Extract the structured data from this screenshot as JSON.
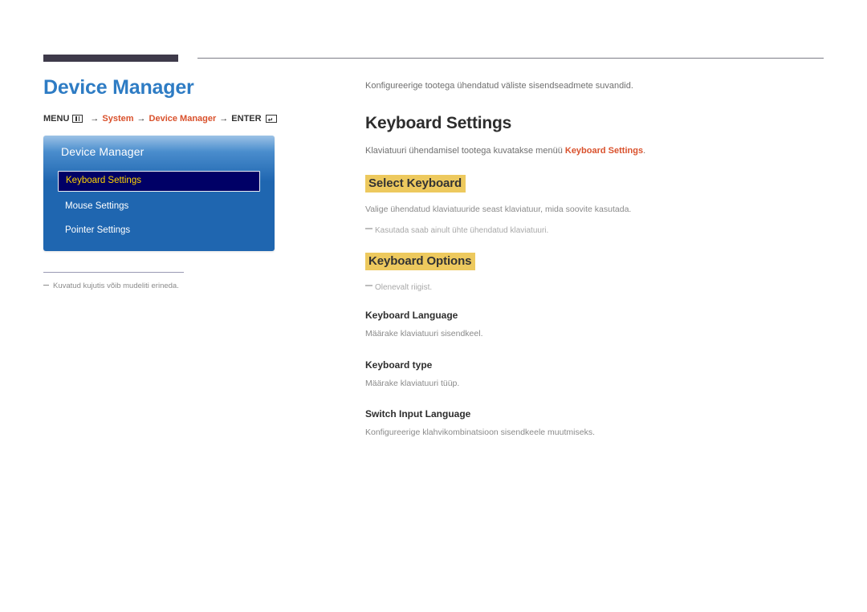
{
  "page": {
    "title": "Device Manager",
    "language": "Estonian"
  },
  "menu_path": {
    "prefix": "MENU",
    "menu_icon": "menu-grid-icon",
    "arrow": "→",
    "step1": "System",
    "step2": "Device Manager",
    "enter_label": "ENTER",
    "enter_icon": "enter-return-icon"
  },
  "osd": {
    "title": "Device Manager",
    "items": [
      {
        "label": "Keyboard Settings",
        "selected": true
      },
      {
        "label": "Mouse Settings",
        "selected": false
      },
      {
        "label": "Pointer Settings",
        "selected": false
      }
    ]
  },
  "left_footnote": {
    "dash": "–",
    "text": "Kuvatud kujutis võib mudeliti erineda."
  },
  "content": {
    "intro": "Konfigureerige tootega ühendatud väliste sisendseadmete suvandid.",
    "heading": "Keyboard Settings",
    "heading_desc_before": "Klaviatuuri ühendamisel tootega kuvatakse menüü ",
    "heading_desc_accent": "Keyboard Settings",
    "heading_desc_after": ".",
    "select_keyboard": {
      "title": "Select Keyboard",
      "desc": "Valige ühendatud klaviatuuride seast klaviatuur, mida soovite kasutada.",
      "note": "Kasutada saab ainult ühte ühendatud klaviatuuri."
    },
    "keyboard_options": {
      "title": "Keyboard Options",
      "note": "Olenevalt riigist.",
      "subsections": [
        {
          "title": "Keyboard Language",
          "desc": "Määrake klaviatuuri sisendkeel."
        },
        {
          "title": "Keyboard type",
          "desc": "Määrake klaviatuuri tüüp."
        },
        {
          "title": "Switch Input Language",
          "desc": "Konfigureerige klahvikombinatsioon sisendkeele muutmiseks."
        }
      ]
    }
  },
  "colors": {
    "title_blue": "#2e7cc4",
    "accent_orange": "#d9512c",
    "highlight_gold": "#edc95e",
    "osd_blue": "#1f66b0",
    "osd_selected_bg": "#000066",
    "osd_selected_text": "#ffd400",
    "rule_dark": "#3e3a4a"
  }
}
